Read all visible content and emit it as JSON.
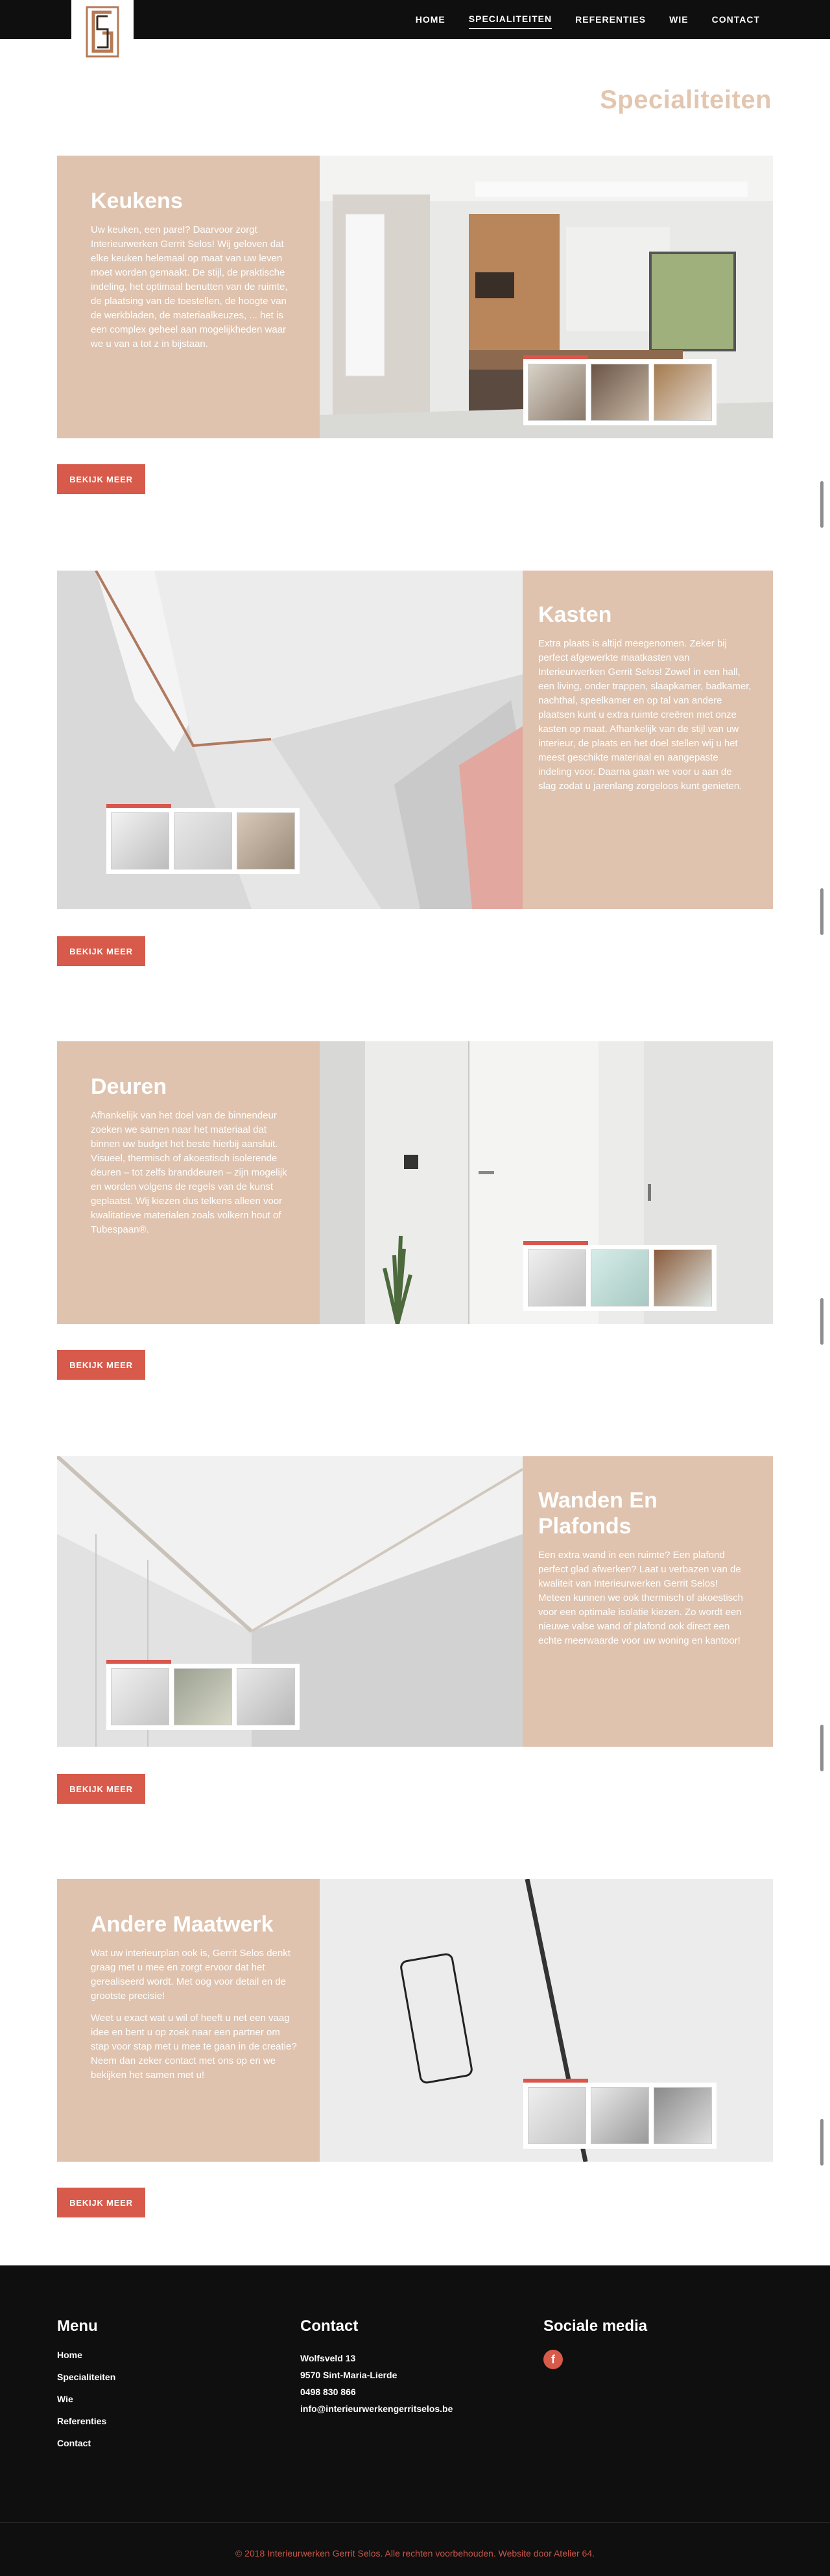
{
  "nav": {
    "items": [
      {
        "label": "HOME"
      },
      {
        "label": "SPECIALITEITEN"
      },
      {
        "label": "REFERENTIES"
      },
      {
        "label": "WIE"
      },
      {
        "label": "CONTACT"
      }
    ],
    "active_index": 1
  },
  "page_title": "Specialiteiten",
  "sections": [
    {
      "title": "Keukens",
      "paragraphs": [
        "Uw keuken, een parel? Daarvoor zorgt Interieurwerken Gerrit Selos! Wij geloven dat elke keuken helemaal op maat van uw leven moet worden gemaakt. De stijl, de praktische indeling, het optimaal benutten van de ruimte, de plaatsing van de toestellen, de hoogte van de werkbladen, de materiaalkeuzes, ... het is een complex geheel aan mogelijkheden waar we u van a tot z in bijstaan."
      ],
      "button": "BEKIJK MEER"
    },
    {
      "title": "Kasten",
      "paragraphs": [
        "Extra plaats is altijd meegenomen. Zeker bij perfect afgewerkte maatkasten van Interieurwerken Gerrit Selos! Zowel in een hall, een living, onder trappen, slaapkamer, badkamer, nachthal, speelkamer en op tal van andere plaatsen kunt u extra ruimte creëren met onze kasten op maat. Afhankelijk van de stijl van uw interieur, de plaats en het doel stellen wij u het meest geschikte materiaal en aangepaste indeling voor. Daarna gaan we voor u aan de slag zodat u jarenlang zorgeloos kunt genieten."
      ],
      "button": "BEKIJK MEER"
    },
    {
      "title": "Deuren",
      "paragraphs": [
        "Afhankelijk van het doel van de binnendeur zoeken we samen naar het materiaal dat binnen uw budget het beste hierbij aansluit. Visueel, thermisch of akoestisch isolerende deuren – tot zelfs branddeuren – zijn mogelijk en worden volgens de regels van de kunst geplaatst. Wij kiezen dus telkens alleen voor kwalitatieve materialen zoals volkern hout of Tubespaan®."
      ],
      "button": "BEKIJK MEER"
    },
    {
      "title": "Wanden En Plafonds",
      "paragraphs": [
        "Een extra wand in een ruimte? Een plafond perfect glad afwerken? Laat u verbazen van de kwaliteit van Interieurwerken Gerrit Selos! Meteen kunnen we ook thermisch of akoestisch voor een optimale isolatie kiezen. Zo wordt een nieuwe valse wand of plafond ook direct een echte meerwaarde voor uw woning en kantoor!"
      ],
      "button": "BEKIJK MEER"
    },
    {
      "title": "Andere Maatwerk",
      "paragraphs": [
        "Wat uw interieurplan ook is, Gerrit Selos denkt graag met u mee en zorgt ervoor dat het gerealiseerd wordt. Met oog voor detail en de grootste precisie!",
        "Weet u exact wat u wil of heeft u net een vaag idee en bent u op zoek naar een partner om stap voor stap met u mee te gaan in de creatie? Neem dan zeker contact met ons op en we bekijken het samen met u!"
      ],
      "button": "BEKIJK MEER"
    }
  ],
  "footer": {
    "menu": {
      "heading": "Menu",
      "links": [
        "Home",
        "Specialiteiten",
        "Wie",
        "Referenties",
        "Contact"
      ]
    },
    "contact": {
      "heading": "Contact",
      "lines": [
        "Wolfsveld 13",
        "9570 Sint-Maria-Lierde",
        "0498 830 866",
        "info@interieurwerkengerritselos.be"
      ]
    },
    "social": {
      "heading": "Sociale media",
      "facebook_icon": "f"
    },
    "copyright": "© 2018 Interieurwerken Gerrit Selos. Alle rechten voorbehouden. Website door Atelier 64."
  },
  "colors": {
    "accent_beige": "#dfc3ae",
    "title_beige": "#e3c6b0",
    "button_red": "#d75a4a",
    "dark": "#0f0f0f"
  }
}
